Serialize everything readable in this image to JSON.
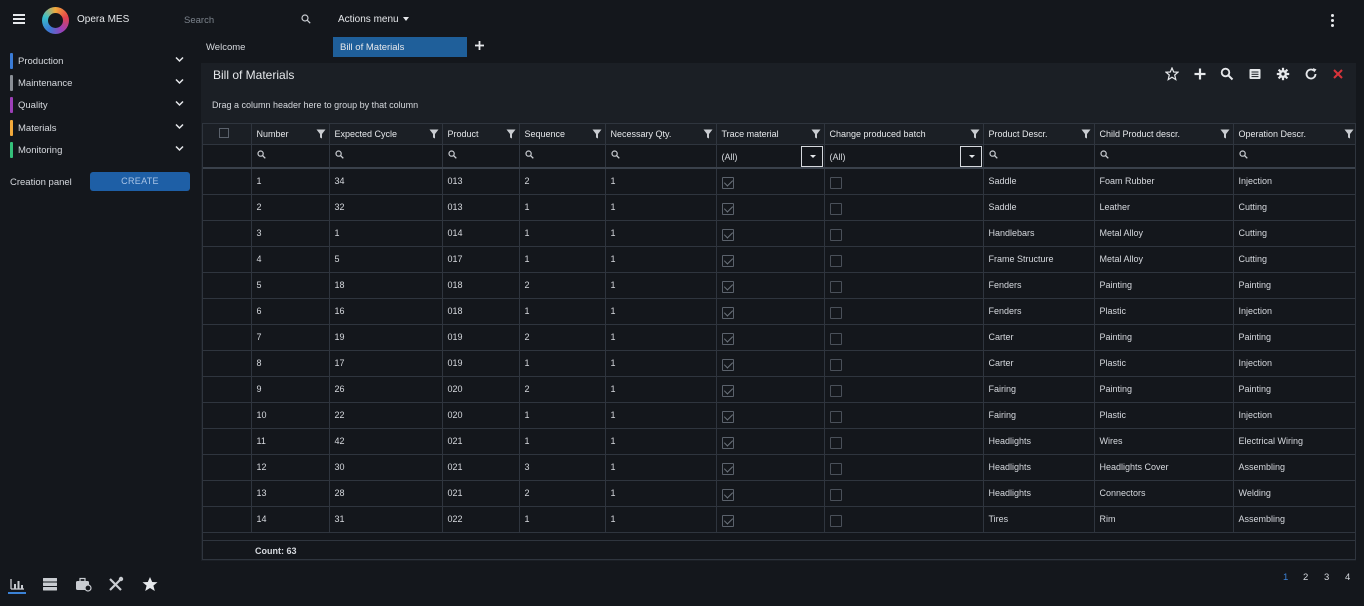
{
  "app": {
    "title": "Opera MES"
  },
  "search": {
    "placeholder": "Search"
  },
  "actions_menu": {
    "label": "Actions menu"
  },
  "sidebar": {
    "items": [
      {
        "label": "Production",
        "color": "#3a7bd5"
      },
      {
        "label": "Maintenance",
        "color": "#8a8f96"
      },
      {
        "label": "Quality",
        "color": "#9c3fb7"
      },
      {
        "label": "Materials",
        "color": "#f2a93b"
      },
      {
        "label": "Monitoring",
        "color": "#34c07a"
      }
    ],
    "creation_label": "Creation panel",
    "create_button": "CREATE"
  },
  "tabs": {
    "welcome": "Welcome",
    "active": "Bill of Materials"
  },
  "panel": {
    "title": "Bill of Materials",
    "group_hint": "Drag a column header here to group by that column",
    "count": "Count: 63"
  },
  "columns": [
    "Number",
    "Expected Cycle",
    "Product",
    "Sequence",
    "Necessary Qty.",
    "Trace material",
    "Change produced batch",
    "Product Descr.",
    "Child Product descr.",
    "Operation Descr."
  ],
  "filters": {
    "trace_material": "(All)",
    "change_produced_batch": "(All)"
  },
  "rows": [
    {
      "number": "1",
      "cycle": "34",
      "product": "013",
      "sequence": "2",
      "qty": "1",
      "trace": true,
      "change": false,
      "product_descr": "Saddle",
      "child_descr": "Foam Rubber",
      "operation": "Injection"
    },
    {
      "number": "2",
      "cycle": "32",
      "product": "013",
      "sequence": "1",
      "qty": "1",
      "trace": true,
      "change": false,
      "product_descr": "Saddle",
      "child_descr": "Leather",
      "operation": "Cutting"
    },
    {
      "number": "3",
      "cycle": "1",
      "product": "014",
      "sequence": "1",
      "qty": "1",
      "trace": true,
      "change": false,
      "product_descr": "Handlebars",
      "child_descr": "Metal Alloy",
      "operation": "Cutting"
    },
    {
      "number": "4",
      "cycle": "5",
      "product": "017",
      "sequence": "1",
      "qty": "1",
      "trace": true,
      "change": false,
      "product_descr": "Frame Structure",
      "child_descr": "Metal Alloy",
      "operation": "Cutting"
    },
    {
      "number": "5",
      "cycle": "18",
      "product": "018",
      "sequence": "2",
      "qty": "1",
      "trace": true,
      "change": false,
      "product_descr": "Fenders",
      "child_descr": "Painting",
      "operation": "Painting"
    },
    {
      "number": "6",
      "cycle": "16",
      "product": "018",
      "sequence": "1",
      "qty": "1",
      "trace": true,
      "change": false,
      "product_descr": "Fenders",
      "child_descr": "Plastic",
      "operation": "Injection"
    },
    {
      "number": "7",
      "cycle": "19",
      "product": "019",
      "sequence": "2",
      "qty": "1",
      "trace": true,
      "change": false,
      "product_descr": "Carter",
      "child_descr": "Painting",
      "operation": "Painting"
    },
    {
      "number": "8",
      "cycle": "17",
      "product": "019",
      "sequence": "1",
      "qty": "1",
      "trace": true,
      "change": false,
      "product_descr": "Carter",
      "child_descr": "Plastic",
      "operation": "Injection"
    },
    {
      "number": "9",
      "cycle": "26",
      "product": "020",
      "sequence": "2",
      "qty": "1",
      "trace": true,
      "change": false,
      "product_descr": "Fairing",
      "child_descr": "Painting",
      "operation": "Painting"
    },
    {
      "number": "10",
      "cycle": "22",
      "product": "020",
      "sequence": "1",
      "qty": "1",
      "trace": true,
      "change": false,
      "product_descr": "Fairing",
      "child_descr": "Plastic",
      "operation": "Injection"
    },
    {
      "number": "11",
      "cycle": "42",
      "product": "021",
      "sequence": "1",
      "qty": "1",
      "trace": true,
      "change": false,
      "product_descr": "Headlights",
      "child_descr": "Wires",
      "operation": "Electrical Wiring"
    },
    {
      "number": "12",
      "cycle": "30",
      "product": "021",
      "sequence": "3",
      "qty": "1",
      "trace": true,
      "change": false,
      "product_descr": "Headlights",
      "child_descr": "Headlights Cover",
      "operation": "Assembling"
    },
    {
      "number": "13",
      "cycle": "28",
      "product": "021",
      "sequence": "2",
      "qty": "1",
      "trace": true,
      "change": false,
      "product_descr": "Headlights",
      "child_descr": "Connectors",
      "operation": "Welding"
    },
    {
      "number": "14",
      "cycle": "31",
      "product": "022",
      "sequence": "1",
      "qty": "1",
      "trace": true,
      "change": false,
      "product_descr": "Tires",
      "child_descr": "Rim",
      "operation": "Assembling"
    }
  ],
  "pager": {
    "pages": [
      "1",
      "2",
      "3",
      "4"
    ],
    "current": "1"
  }
}
